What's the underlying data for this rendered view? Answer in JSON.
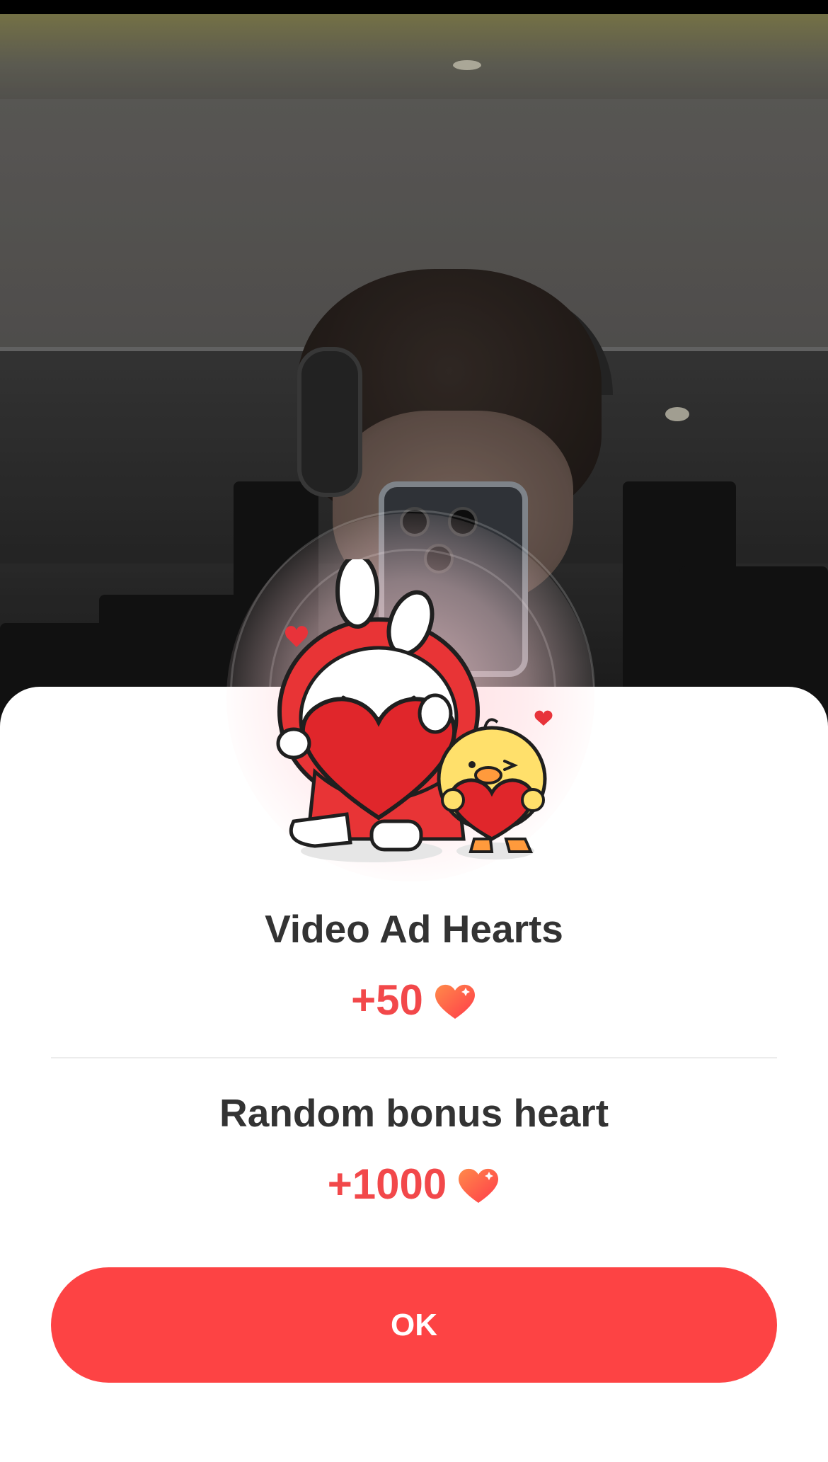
{
  "reward_popup": {
    "video_ad": {
      "title": "Video Ad Hearts",
      "amount": "+50",
      "icon": "heart-icon"
    },
    "bonus": {
      "title": "Random bonus heart",
      "amount": "+1000",
      "icon": "heart-icon"
    },
    "ok_label": "OK"
  },
  "colors": {
    "accent": "#fd4344",
    "amount_text": "#f2484a",
    "title_text": "#333333",
    "sheet_background": "#ffffff"
  }
}
